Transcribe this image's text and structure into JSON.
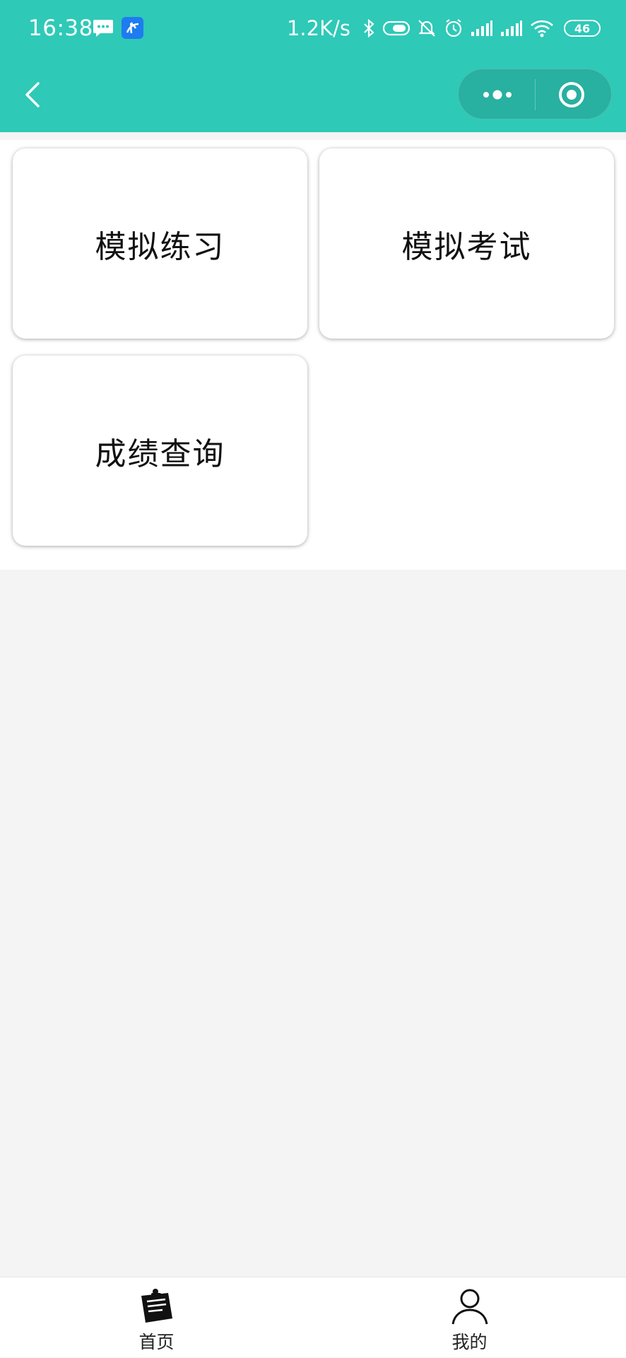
{
  "status_bar": {
    "time": "16:38",
    "network_speed": "1.2K/s",
    "battery_level": "46",
    "background_color": "#2ec9b7",
    "icons": [
      "message-icon",
      "app-notification-icon",
      "bluetooth-icon",
      "toggle-icon",
      "mute-icon",
      "alarm-icon",
      "signal-icon",
      "signal-icon",
      "wifi-icon",
      "battery-icon"
    ]
  },
  "nav_bar": {
    "background_color": "#2ec9b7",
    "icons": [
      "back-arrow-icon",
      "more-dots-icon",
      "close-target-icon"
    ]
  },
  "menu": {
    "items": [
      {
        "label": "模拟练习"
      },
      {
        "label": "模拟考试"
      },
      {
        "label": "成绩查询"
      }
    ]
  },
  "tab_bar": {
    "tabs": [
      {
        "label": "首页",
        "icon": "home-clipboard-icon",
        "selected": true
      },
      {
        "label": "我的",
        "icon": "user-icon",
        "selected": false
      }
    ]
  }
}
